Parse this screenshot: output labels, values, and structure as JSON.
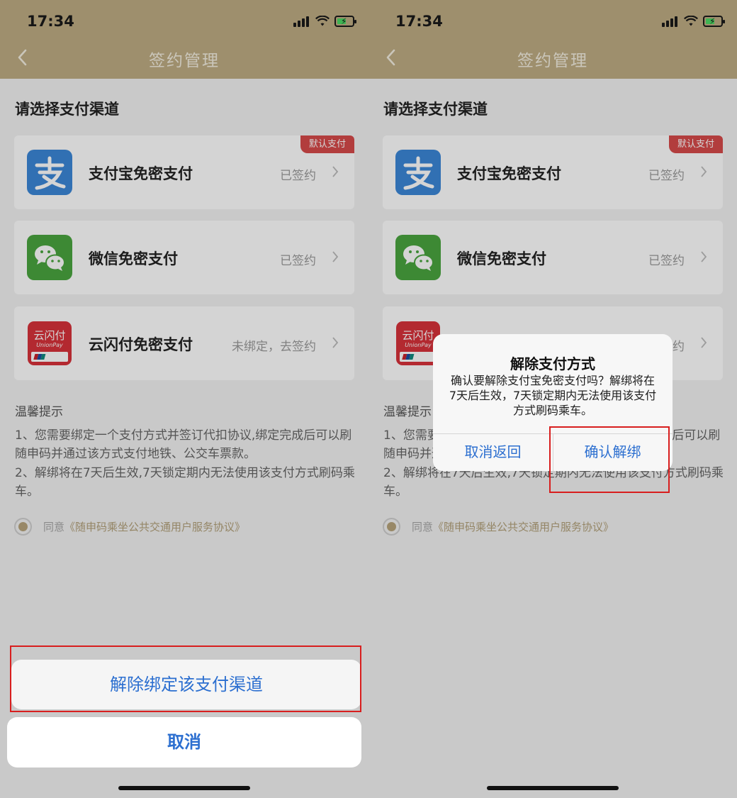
{
  "status": {
    "time": "17:34"
  },
  "nav": {
    "title": "签约管理"
  },
  "section": {
    "title": "请选择支付渠道"
  },
  "payments": [
    {
      "name": "支付宝免密支付",
      "status": "已签约",
      "badge": "默认支付",
      "icon": "alipay-icon",
      "color": "#3b87d8"
    },
    {
      "name": "微信免密支付",
      "status": "已签约",
      "icon": "wechat-icon",
      "color": "#4aa53f"
    },
    {
      "name": "云闪付免密支付",
      "status": "未绑定，去签约",
      "icon": "unionpay-icon",
      "color": "#d8323a",
      "logo_text": "云闪付",
      "logo_sub": "UnionPay"
    }
  ],
  "tips": {
    "title": "温馨提示",
    "line1": "1、您需要绑定一个支付方式并签订代扣协议,绑定完成后可以刷随申码并通过该方式支付地铁、公交车票款。",
    "line2": "2、解绑将在7天后生效,7天锁定期内无法使用该支付方式刷码乘车。"
  },
  "agreement": {
    "prefix": "同意",
    "link": "《随申码乘坐公共交通用户服务协议》"
  },
  "sheet": {
    "action_label": "解除绑定该支付渠道",
    "cancel_label": "取消"
  },
  "dialog": {
    "title": "解除支付方式",
    "message": "确认要解除支付宝免密支付吗？解绑将在7天后生效，7天锁定期内无法使用该支付方式刷码乘车。",
    "cancel_label": "取消返回",
    "confirm_label": "确认解绑"
  },
  "colors": {
    "header": "#bfac84",
    "accent_blue": "#2c6fd0",
    "badge_red": "#d64a4a",
    "highlight_red": "#d81e1e"
  }
}
